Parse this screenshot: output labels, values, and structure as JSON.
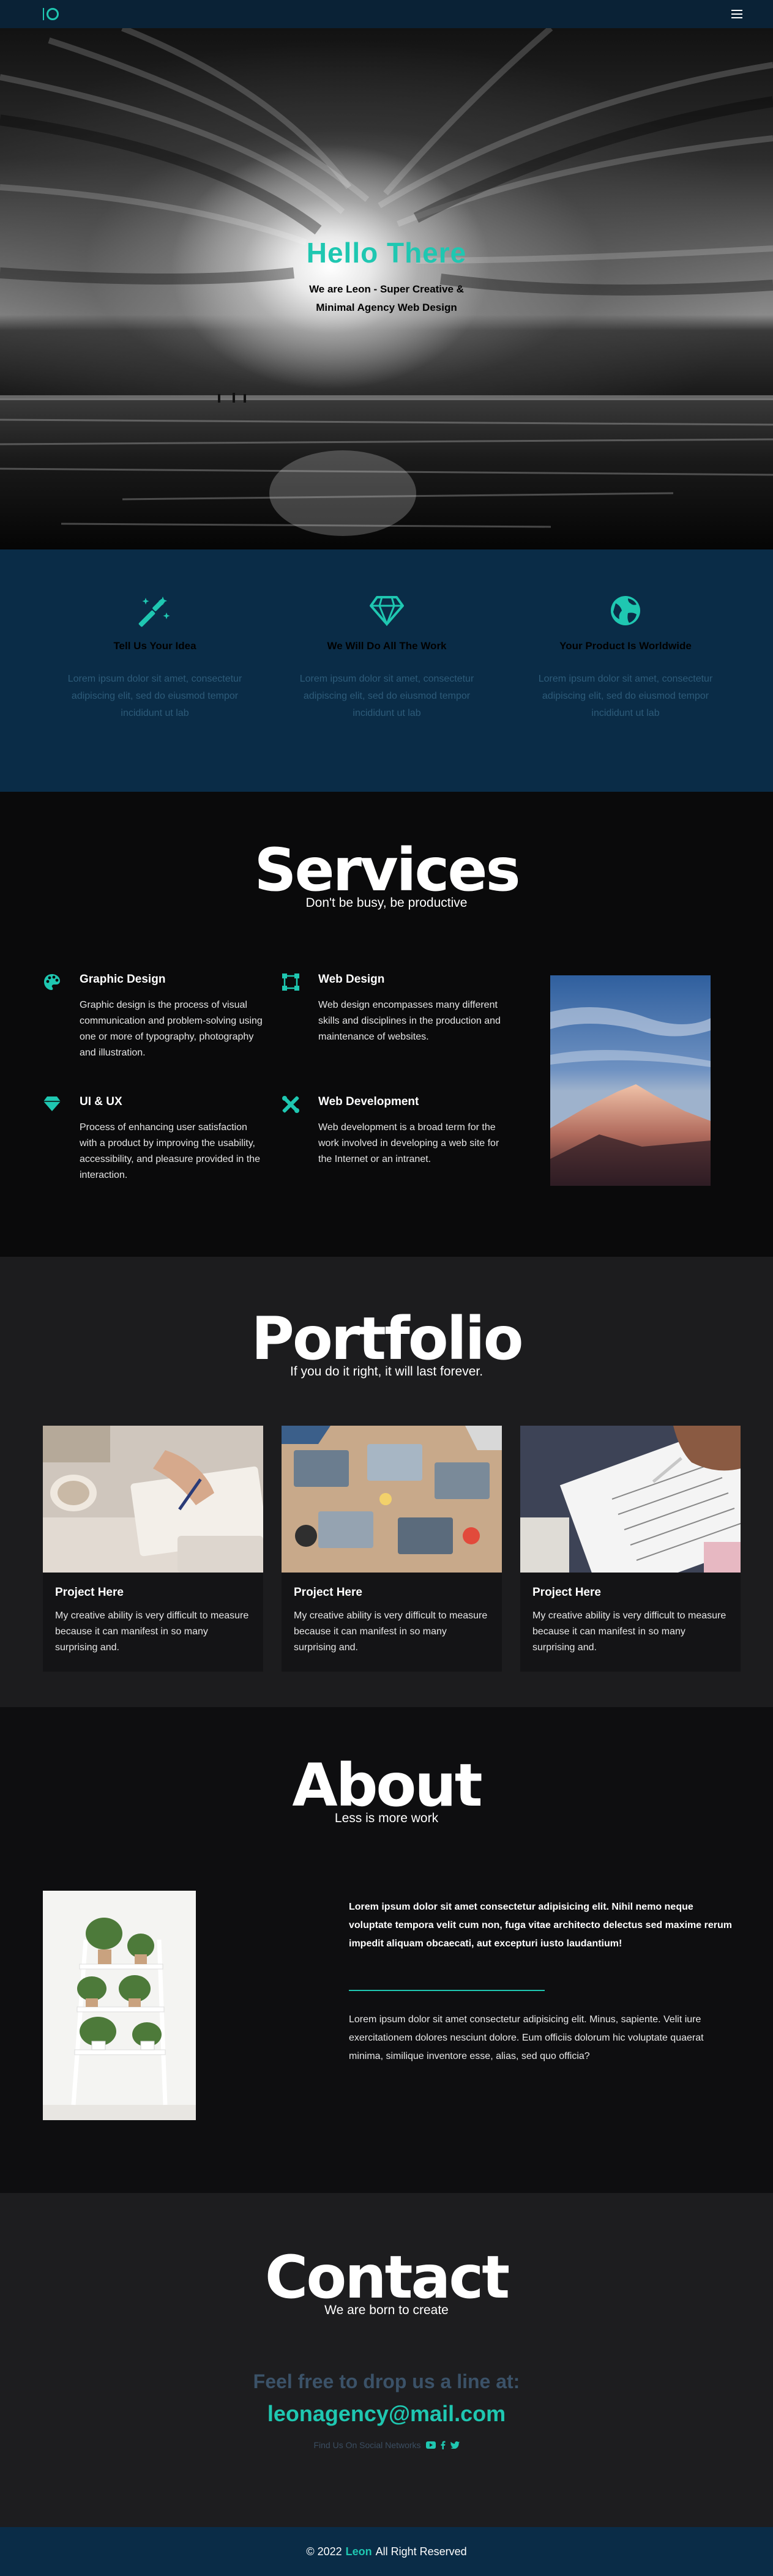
{
  "nav": {
    "logo_icon": "logo-ring-icon",
    "menu_icon": "hamburger-icon"
  },
  "hero": {
    "title": "Hello There",
    "subtitle": "We are Leon - Super Creative & Minimal Agency Web Design"
  },
  "features": [
    {
      "icon": "magic-wand-icon",
      "title": "Tell Us Your Idea",
      "text": "Lorem ipsum dolor sit amet, consectetur adipiscing elit, sed do eiusmod tempor incididunt ut lab"
    },
    {
      "icon": "diamond-icon",
      "title": "We Will Do All The Work",
      "text": "Lorem ipsum dolor sit amet, consectetur adipiscing elit, sed do eiusmod tempor incididunt ut lab"
    },
    {
      "icon": "globe-icon",
      "title": "Your Product Is Worldwide",
      "text": "Lorem ipsum dolor sit amet, consectetur adipiscing elit, sed do eiusmod tempor incididunt ut lab"
    }
  ],
  "services": {
    "title": "Services",
    "subtitle": "Don't be busy, be productive",
    "items": [
      {
        "icon": "palette-icon",
        "title": "Graphic Design",
        "text": "Graphic design is the process of visual communication and problem-solving using one or more of typography, photography and illustration."
      },
      {
        "icon": "vector-square-icon",
        "title": "Web Design",
        "text": "Web design encompasses many different skills and disciplines in the production and maintenance of websites."
      },
      {
        "icon": "gem-icon",
        "title": "UI & UX",
        "text": "Process of enhancing user satisfaction with a product by improving the usability, accessibility, and pleasure provided in the interaction."
      },
      {
        "icon": "tools-icon",
        "title": "Web Development",
        "text": "Web development is a broad term for the work involved in developing a web site for the Internet or an intranet."
      }
    ]
  },
  "portfolio": {
    "title": "Portfolio",
    "subtitle": "If you do it right, it will last forever.",
    "cards": [
      {
        "title": "Project Here",
        "text": "My creative ability is very difficult to measure because it can manifest in so many surprising and."
      },
      {
        "title": "Project Here",
        "text": "My creative ability is very difficult to measure because it can manifest in so many surprising and."
      },
      {
        "title": "Project Here",
        "text": "My creative ability is very difficult to measure because it can manifest in so many surprising and."
      }
    ]
  },
  "about": {
    "title": "About",
    "subtitle": "Less is more work",
    "bold_text": "Lorem ipsum dolor sit amet consectetur adipisicing elit. Nihil nemo neque voluptate tempora velit cum non, fuga vitae architecto delectus sed maxime rerum impedit aliquam obcaecati, aut excepturi iusto laudantium!",
    "text": "Lorem ipsum dolor sit amet consectetur adipisicing elit. Minus, sapiente. Velit iure exercitationem dolores nesciunt dolore. Eum officiis dolorum hic voluptate quaerat minima, similique inventore esse, alias, sed quo officia?"
  },
  "contact": {
    "title": "Contact",
    "subtitle": "We are born to create",
    "prompt": "Feel free to drop us a line at:",
    "email": "leonagency@mail.com",
    "social_label": "Find Us On Social Networks"
  },
  "footer": {
    "prefix": "© 2022",
    "brand": "Leon",
    "suffix": "All Right Reserved"
  },
  "colors": {
    "accent": "#1fc7b1",
    "nav_bg": "#0a2236",
    "features_bg": "#0a2c47"
  }
}
